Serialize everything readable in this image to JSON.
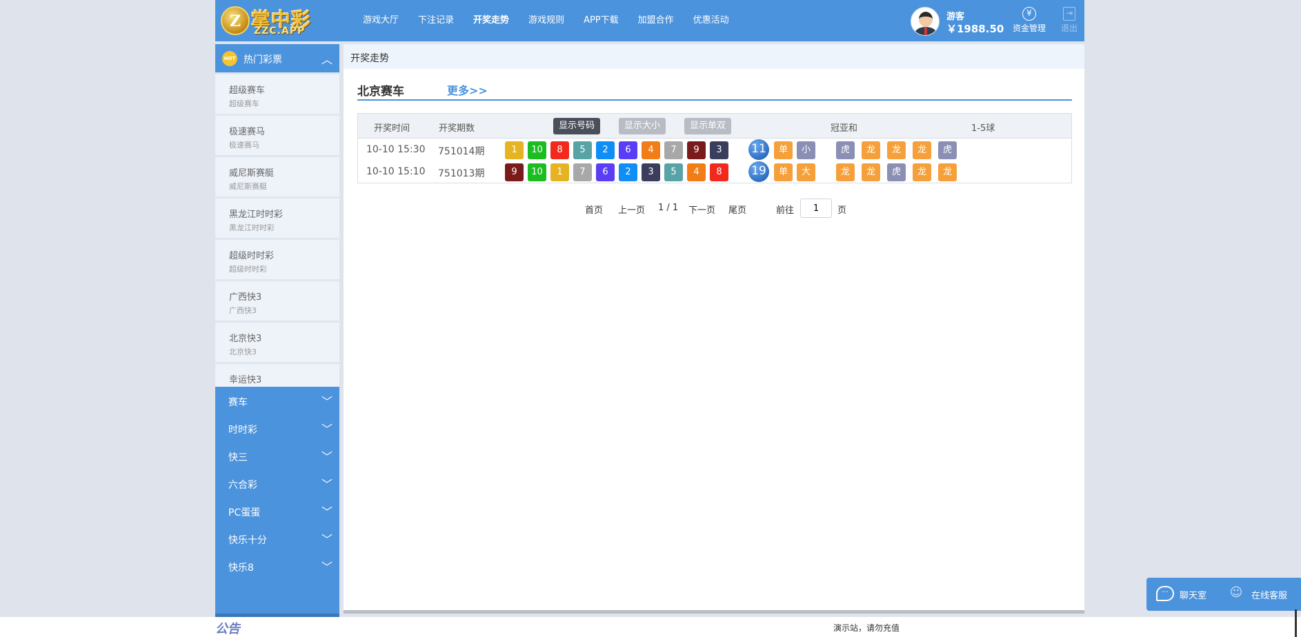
{
  "header": {
    "logo_text": "掌中彩",
    "logo_sub": "ZZC.APP",
    "nav": [
      "游戏大厅",
      "下注记录",
      "开奖走势",
      "游戏规则",
      "APP下载",
      "加盟合作",
      "优惠活动"
    ],
    "nav_active_index": 2,
    "user_name": "游客",
    "balance": "￥1988.50",
    "fund_label": "资金管理",
    "logout_label": "退出"
  },
  "sidebar": {
    "hot_label": "热门彩票",
    "hot_icon": "HOT",
    "lotteries": [
      {
        "name": "超级赛车",
        "sub": "超级赛车"
      },
      {
        "name": "极速赛马",
        "sub": "极速赛马"
      },
      {
        "name": "威尼斯赛艇",
        "sub": "威尼斯赛艇"
      },
      {
        "name": "黑龙江时时彩",
        "sub": "黑龙江时时彩"
      },
      {
        "name": "超级时时彩",
        "sub": "超级时时彩"
      },
      {
        "name": "广西快3",
        "sub": "广西快3"
      },
      {
        "name": "北京快3",
        "sub": "北京快3"
      },
      {
        "name": "幸运快3",
        "sub": ""
      }
    ],
    "categories": [
      "赛车",
      "时时彩",
      "快三",
      "六合彩",
      "PC蛋蛋",
      "快乐十分",
      "快乐8"
    ]
  },
  "main": {
    "breadcrumb": "开奖走势",
    "section_title": "北京赛车",
    "more_link": "更多>>",
    "table": {
      "col_time": "开奖时间",
      "col_issue": "开奖期数",
      "btn_number": "显示号码",
      "btn_size": "显示大小",
      "btn_oddeven": "显示单双",
      "col_sum": "冠亚和",
      "col_balls": "1-5球",
      "rows": [
        {
          "time": "10-10 15:30",
          "issue": "751014期",
          "balls": [
            "1",
            "10",
            "8",
            "5",
            "2",
            "6",
            "4",
            "7",
            "9",
            "3"
          ],
          "sum": "11",
          "sum_tags": [
            "单",
            "小"
          ],
          "dt": [
            "虎",
            "龙",
            "龙",
            "龙",
            "虎"
          ]
        },
        {
          "time": "10-10 15:10",
          "issue": "751013期",
          "balls": [
            "9",
            "10",
            "1",
            "7",
            "6",
            "2",
            "3",
            "5",
            "4",
            "8"
          ],
          "sum": "19",
          "sum_tags": [
            "单",
            "大"
          ],
          "dt": [
            "龙",
            "龙",
            "虎",
            "龙",
            "龙"
          ]
        }
      ]
    },
    "pager": {
      "first": "首页",
      "prev": "上一页",
      "status": "1 / 1",
      "next": "下一页",
      "last": "尾页",
      "goto_label": "前往",
      "page_value": "1",
      "page_unit": "页"
    }
  },
  "footer": {
    "notice_label": "公告",
    "notice_text": "演示站，请勿充值"
  },
  "float_panel": {
    "chat": "聊天室",
    "service": "在线客服"
  },
  "colors": {
    "accent": "#4b93dc",
    "ball": {
      "1": "#e6b422",
      "2": "#0f8ef5",
      "3": "#3a3d5c",
      "4": "#f27c16",
      "5": "#57a3a6",
      "6": "#5a3ef5",
      "7": "#a8a8a8",
      "8": "#f22a1e",
      "9": "#7a1a1a",
      "10": "#1bbd20"
    },
    "tag_orange": "#f5a03a",
    "tag_grey": "#8a8fb3"
  }
}
